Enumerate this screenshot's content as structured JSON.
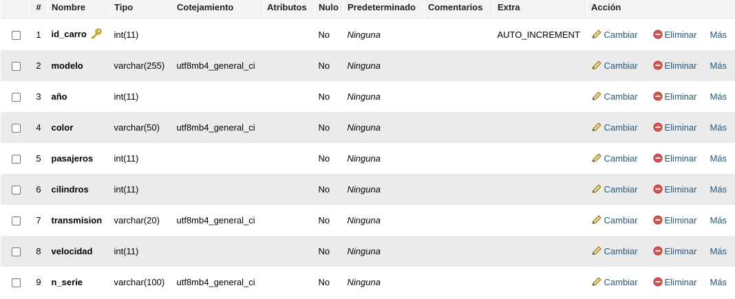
{
  "columns": {
    "number": "#",
    "name": "Nombre",
    "type": "Tipo",
    "collation": "Cotejamiento",
    "attributes": "Atributos",
    "null": "Nulo",
    "default": "Predeterminado",
    "comments": "Comentarios",
    "extra": "Extra",
    "action": "Acción"
  },
  "actions": {
    "change": "Cambiar",
    "drop": "Eliminar",
    "more": "Más"
  },
  "icons": {
    "primary_key": "key-icon",
    "change": "pencil-icon",
    "drop": "delete-circle-icon"
  },
  "colors": {
    "link": "#235a81",
    "row_alt": "#ebebeb",
    "header": "#f3f3f3",
    "key": "#e5b728",
    "drop": "#d9534f"
  },
  "rows": [
    {
      "num": "1",
      "name": "id_carro",
      "type": "int(11)",
      "collation": "",
      "attributes": "",
      "null": "No",
      "default": "Ninguna",
      "comments": "",
      "extra": "AUTO_INCREMENT",
      "primary_key": true
    },
    {
      "num": "2",
      "name": "modelo",
      "type": "varchar(255)",
      "collation": "utf8mb4_general_ci",
      "attributes": "",
      "null": "No",
      "default": "Ninguna",
      "comments": "",
      "extra": ""
    },
    {
      "num": "3",
      "name": "año",
      "type": "int(11)",
      "collation": "",
      "attributes": "",
      "null": "No",
      "default": "Ninguna",
      "comments": "",
      "extra": ""
    },
    {
      "num": "4",
      "name": "color",
      "type": "varchar(50)",
      "collation": "utf8mb4_general_ci",
      "attributes": "",
      "null": "No",
      "default": "Ninguna",
      "comments": "",
      "extra": ""
    },
    {
      "num": "5",
      "name": "pasajeros",
      "type": "int(11)",
      "collation": "",
      "attributes": "",
      "null": "No",
      "default": "Ninguna",
      "comments": "",
      "extra": ""
    },
    {
      "num": "6",
      "name": "cilindros",
      "type": "int(11)",
      "collation": "",
      "attributes": "",
      "null": "No",
      "default": "Ninguna",
      "comments": "",
      "extra": ""
    },
    {
      "num": "7",
      "name": "transmision",
      "type": "varchar(20)",
      "collation": "utf8mb4_general_ci",
      "attributes": "",
      "null": "No",
      "default": "Ninguna",
      "comments": "",
      "extra": ""
    },
    {
      "num": "8",
      "name": "velocidad",
      "type": "int(11)",
      "collation": "",
      "attributes": "",
      "null": "No",
      "default": "Ninguna",
      "comments": "",
      "extra": ""
    },
    {
      "num": "9",
      "name": "n_serie",
      "type": "varchar(100)",
      "collation": "utf8mb4_general_ci",
      "attributes": "",
      "null": "No",
      "default": "Ninguna",
      "comments": "",
      "extra": ""
    }
  ]
}
